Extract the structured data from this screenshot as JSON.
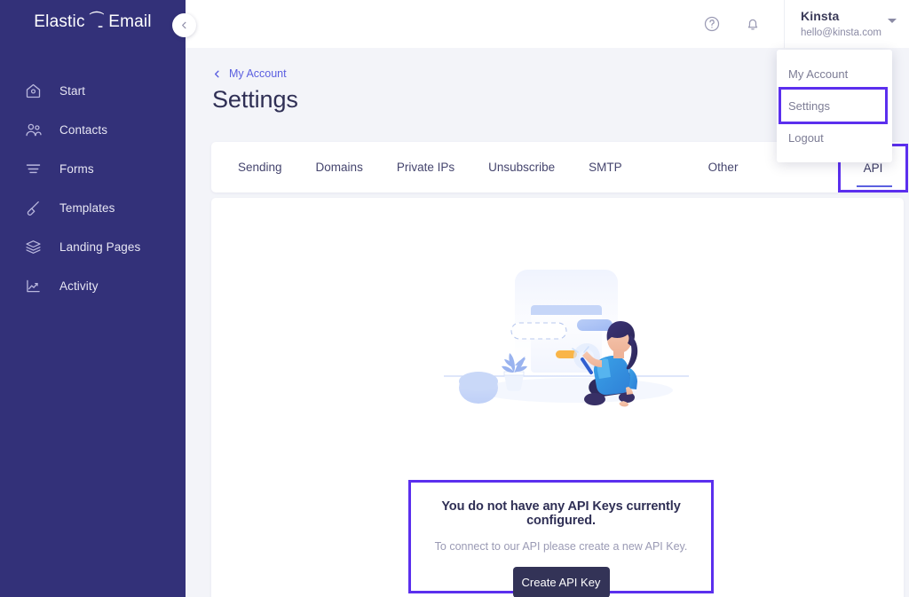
{
  "brand": {
    "name_part1": "Elastic",
    "link_glyph": "⧉",
    "name_part2": "Email"
  },
  "colors": {
    "sidebar": "#333179",
    "accent_purple": "#5b2fee",
    "link_blue": "#5b5fe0",
    "button_dark": "#333357",
    "page_bg": "#f3f4f9"
  },
  "sidebar": {
    "collapse_icon": "chevron-left-icon",
    "items": [
      {
        "label": "Start",
        "icon": "home-icon"
      },
      {
        "label": "Contacts",
        "icon": "people-icon"
      },
      {
        "label": "Forms",
        "icon": "form-lines-icon"
      },
      {
        "label": "Templates",
        "icon": "brush-icon"
      },
      {
        "label": "Landing Pages",
        "icon": "layers-icon"
      },
      {
        "label": "Activity",
        "icon": "chart-line-icon"
      }
    ]
  },
  "topbar": {
    "help_icon": "question-circle-icon",
    "bell_icon": "bell-icon",
    "user": {
      "name": "Kinsta",
      "email": "hello@kinsta.com",
      "caret_icon": "caret-down-icon"
    }
  },
  "user_menu": {
    "items": [
      {
        "label": "My Account",
        "highlighted": false
      },
      {
        "label": "Settings",
        "highlighted": true
      },
      {
        "label": "Logout",
        "highlighted": false
      }
    ]
  },
  "page": {
    "breadcrumb": "My Account",
    "breadcrumb_icon": "chevron-left-icon",
    "title": "Settings"
  },
  "tabs": {
    "items": [
      {
        "label": "Sending"
      },
      {
        "label": "Domains"
      },
      {
        "label": "Private IPs"
      },
      {
        "label": "Unsubscribe"
      },
      {
        "label": "SMTP"
      },
      {
        "label": "Other"
      }
    ],
    "active": {
      "label": "API",
      "highlighted": true
    }
  },
  "empty_state": {
    "illustration": "woman-with-wand-illustration",
    "title": "You do not have any API Keys currently configured.",
    "subtitle": "To connect to our API please create a new API Key.",
    "button_label": "Create API Key",
    "highlighted": true
  }
}
